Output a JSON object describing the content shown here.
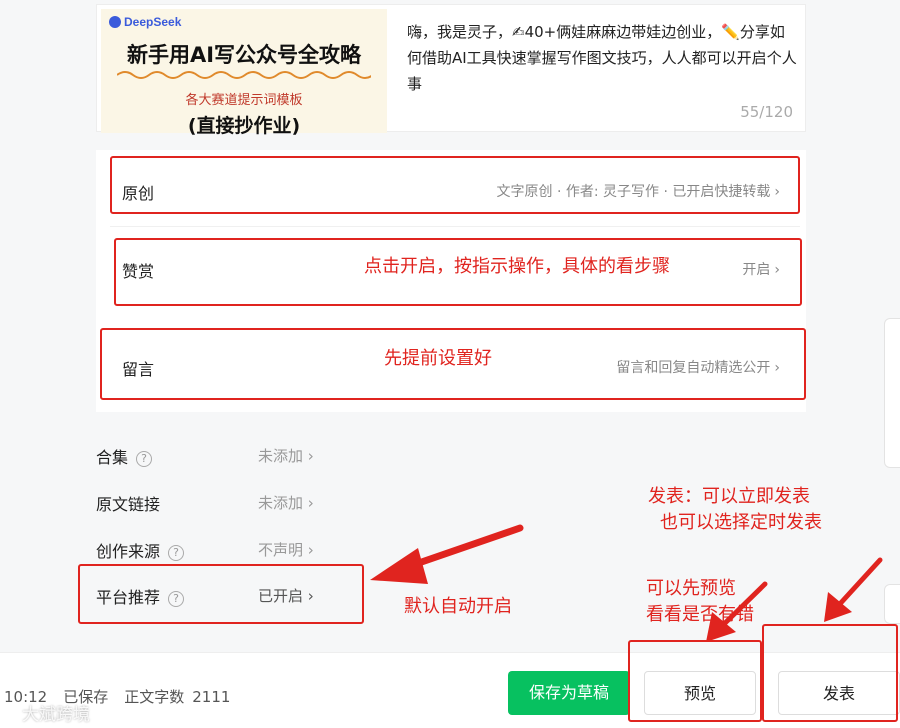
{
  "article": {
    "cover_brand": "DeepSeek",
    "cover_title": "新手用AI写公众号全攻略",
    "cover_subtitle": "各大赛道提示词模板",
    "cover_tag": "(直接抄作业)",
    "description": "嗨，我是灵子，✍40+俩娃麻麻边带娃边创业，✏️分享如何借助AI工具快速掌握写作图文技巧，人人都可以开启个人事",
    "char_count": "55/120"
  },
  "settings": {
    "original": {
      "label": "原创",
      "value": "文字原创 · 作者: 灵子写作 · 已开启快捷转载"
    },
    "reward": {
      "label": "赞赏",
      "value": "开启"
    },
    "comment": {
      "label": "留言",
      "value": "留言和回复自动精选公开"
    }
  },
  "options": {
    "collection": {
      "label": "合集",
      "value": "未添加"
    },
    "source_link": {
      "label": "原文链接",
      "value": "未添加"
    },
    "creation_source": {
      "label": "创作来源",
      "value": "不声明"
    },
    "platform_recommend": {
      "label": "平台推荐",
      "value": "已开启"
    }
  },
  "annotations": {
    "reward_note": "点击开启，按指示操作，具体的看步骤",
    "comment_note": "先提前设置好",
    "auto_on_note": "默认自动开启",
    "publish_note_1": "发表：可以立即发表",
    "publish_note_2": "也可以选择定时发表",
    "preview_note_1": "可以先预览",
    "preview_note_2": "看看是否有错"
  },
  "bottom": {
    "time": "10:12",
    "saved": "已保存",
    "word_count_label": "正文字数",
    "word_count": "2111",
    "save_draft": "保存为草稿",
    "preview": "预览",
    "publish": "发表",
    "watermark": "大斌跨境"
  },
  "colors": {
    "annotation_red": "#e0241f",
    "primary_green": "#07c160"
  }
}
